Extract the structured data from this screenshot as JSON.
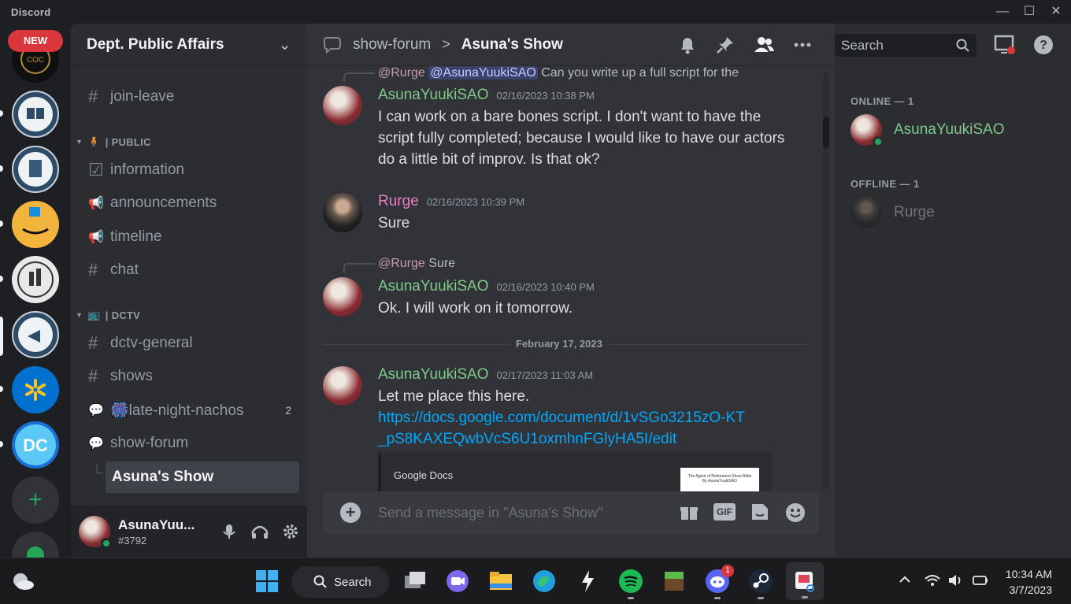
{
  "window": {
    "app_name": "Discord",
    "minimize_glyph": "—",
    "maximize_glyph": "☐",
    "close_glyph": "✕"
  },
  "rail": {
    "new_badge": "NEW",
    "add_glyph": "+",
    "servers": [
      {
        "name": "coc-server",
        "color": "#101010"
      },
      {
        "name": "library-server",
        "color": "#2d4a66"
      },
      {
        "name": "building-server",
        "color": "#3a5a7a"
      },
      {
        "name": "amazon-server",
        "color": "#f2b43c"
      },
      {
        "name": "city-server",
        "color": "#e8e8e8"
      },
      {
        "name": "dept-public-affairs-server",
        "color": "#2d4a66"
      },
      {
        "name": "walmart-server",
        "color": "#0071ce"
      },
      {
        "name": "dc-server",
        "color": "#1a6fd6"
      }
    ]
  },
  "sidebar": {
    "guild_name": "Dept. Public Affairs",
    "chevron": "⌄",
    "channels": [
      {
        "icon": "#",
        "label": "join-leave"
      },
      {
        "category": "| PUBLIC",
        "emoji": "🧍"
      },
      {
        "icon": "☑",
        "label": "information"
      },
      {
        "icon": "📢",
        "label": "announcements"
      },
      {
        "icon": "📢",
        "label": "timeline"
      },
      {
        "icon": "#",
        "label": "chat"
      },
      {
        "category": "| DCTV",
        "emoji": "📺"
      },
      {
        "icon": "#",
        "label": "dctv-general"
      },
      {
        "icon": "#",
        "label": "shows"
      },
      {
        "icon": "💬",
        "label": "🎆late-night-nachos",
        "count": "2"
      },
      {
        "icon": "💬",
        "label": "show-forum"
      },
      {
        "icon": "└",
        "label": "Asuna's Show"
      }
    ],
    "user": {
      "name": "AsunaYuu...",
      "tag": "#3792"
    }
  },
  "chat": {
    "parent_channel": "show-forum",
    "separator": ">",
    "thread_title": "Asuna's Show",
    "search_placeholder": "Search",
    "messages": [
      {
        "reply_author": "@Rurge",
        "reply_mention": "@AsunaYuukiSAO",
        "reply_text": "Can you write up a full script for the",
        "author": "AsunaYuukiSAO",
        "time": "02/16/2023 10:38 PM",
        "body": "I can work on a bare bones script. I don't want to have the script fully completed; because I would like to have our actors do a little bit of improv. Is that ok?"
      },
      {
        "author": "Rurge",
        "time": "02/16/2023 10:39 PM",
        "body": "Sure"
      },
      {
        "reply_author": "@Rurge",
        "reply_text": "Sure",
        "author": "AsunaYuukiSAO",
        "time": "02/16/2023 10:40 PM",
        "body": "Ok. I will work on it tomorrow."
      },
      {
        "author": "AsunaYuukiSAO",
        "time": "02/17/2023 11:03 AM",
        "body": "Let me place this here.",
        "link": "https://docs.google.com/document/d/1vSGo3215zO-KT_pS8KAXEQwbVcS6U1oxmhnFGlyHA5I/edit"
      }
    ],
    "date_divider": "February 17, 2023",
    "embed": {
      "provider": "Google Docs",
      "thumb_line1": "The Agent of Retirement Show Bible",
      "thumb_line2": "By AsunaYuukiSAO"
    },
    "composer_placeholder": "Send a message in \"Asuna's Show\"",
    "gif_label": "GIF"
  },
  "members": {
    "online_header": "ONLINE — 1",
    "offline_header": "OFFLINE — 1",
    "online": [
      "AsunaYuukiSAO"
    ],
    "offline": [
      "Rurge"
    ]
  },
  "taskbar": {
    "search_label": "Search",
    "discord_badge": "1",
    "time": "10:34 AM",
    "date": "3/7/2023"
  }
}
